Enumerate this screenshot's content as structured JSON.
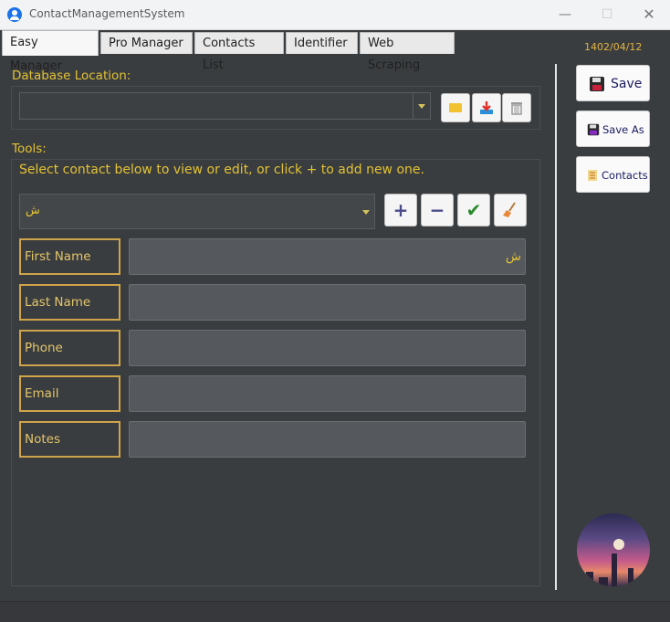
{
  "window": {
    "title": "ContactManagementSystem",
    "min": "—",
    "max": "☐",
    "close": "✕"
  },
  "tabs": [
    {
      "label": "Easy Manager"
    },
    {
      "label": "Pro Manager"
    },
    {
      "label": "Contacts List"
    },
    {
      "label": "Identifier"
    },
    {
      "label": "Web Scraping"
    }
  ],
  "date": "1402/04/12",
  "database": {
    "label": "Database Location:",
    "value": ""
  },
  "tools": {
    "label": "Tools:",
    "hint": "Select contact below to view or edit, or click + to add new one."
  },
  "contact_select": {
    "value": "ش"
  },
  "fields": [
    {
      "label": "First Name",
      "value": "ش"
    },
    {
      "label": "Last Name",
      "value": ""
    },
    {
      "label": "Phone",
      "value": ""
    },
    {
      "label": "Email",
      "value": ""
    },
    {
      "label": "Notes",
      "value": ""
    }
  ],
  "right": {
    "save": "Save",
    "save_as": "Save As",
    "contacts": "Contacts"
  },
  "colors": {
    "accent": "#e3c233",
    "label_border": "#d0a44a",
    "background": "#3a3d40"
  }
}
